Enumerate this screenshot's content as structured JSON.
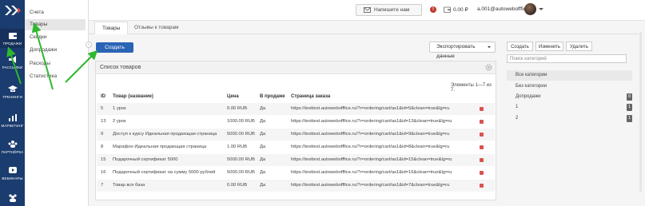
{
  "rail": {
    "items": [
      {
        "label": "ПРОДАЖИ",
        "icon": "wallet-icon"
      },
      {
        "label": "РАССЫЛКИ",
        "icon": "megaphone-icon"
      },
      {
        "label": "ТРЕНИНГИ",
        "icon": "graduation-cap-icon"
      },
      {
        "label": "МАРКЕТИНГ",
        "icon": "chart-icon"
      },
      {
        "label": "ПАРТНЁРКА",
        "icon": "people-icon"
      },
      {
        "label": "ВЕБИНАРЫ",
        "icon": "video-play-icon"
      },
      {
        "label": "",
        "icon": "group-icon"
      }
    ]
  },
  "submenu": {
    "items": [
      "Счета",
      "Товары",
      "Скидки",
      "Допродажи",
      "Расходы",
      "Статистика"
    ]
  },
  "header": {
    "message_button": "Напишите нам",
    "balance": "0.00 ₽",
    "user_email": "a.001@autowebofffice.ru"
  },
  "tabs": [
    "Товары",
    "Отзывы к товарам"
  ],
  "toolbar": {
    "create_label": "Создать",
    "export_label": "Экспортировать данные"
  },
  "products": {
    "title": "Список товаров",
    "counter": "Элементы 1—7 из 7.",
    "columns": [
      "ID",
      "Товар (название)",
      "Цена",
      "В продаже",
      "Страница заказа"
    ],
    "rows": [
      {
        "id": "5",
        "name": "1 урок",
        "price": "0.00 RUB",
        "on_sale": "Да",
        "url": "https://testtest.autowebofffice.ru/?r=ordering/cart/as1&id=5&clean=true&lg=ru"
      },
      {
        "id": "13",
        "name": "2 урок",
        "price": "1000.00 RUB",
        "on_sale": "Да",
        "url": "https://testtest.autowebofffice.ru/?r=ordering/cart/as1&id=13&clean=true&lg=ru"
      },
      {
        "id": "9",
        "name": "Доступ к курсу Идеальная продающая страница",
        "price": "5000.00 RUB",
        "on_sale": "Да",
        "url": "https://testtest.autowebofffice.ru/?r=ordering/cart/as1&id=9&clean=true&lg=ru"
      },
      {
        "id": "8",
        "name": "Марафон Идеальная продающая страница",
        "price": "1.00 RUB",
        "on_sale": "Да",
        "url": "https://testtest.autowebofffice.ru/?r=ordering/cart/as1&id=8&clean=true&lg=ru"
      },
      {
        "id": "15",
        "name": "Подарочный сертификат 5000",
        "price": "5000.00 RUB",
        "on_sale": "Да",
        "url": "https://testtest.autowebofffice.ru/?r=ordering/cart/as1&id=15&clean=true&lg=ru"
      },
      {
        "id": "16",
        "name": "Подарочный сертификат на сумму 5000 рублей",
        "price": "5000.00 RUB",
        "on_sale": "Да",
        "url": "https://testtest.autowebofffice.ru/?r=ordering/cart/as1&id=16&clean=true&lg=ru"
      },
      {
        "id": "7",
        "name": "Товар вся база",
        "price": "0.00 RUB",
        "on_sale": "Да",
        "url": "https://testtest.autowebofffice.ru/?r=ordering/cart/as1&id=7&clean=true&lg=ru"
      }
    ]
  },
  "categories": {
    "create": "Создать",
    "edit": "Изменить",
    "delete": "Удалить",
    "search_placeholder": "Поиск категорий",
    "items": [
      {
        "label": "Все категории",
        "badge": ""
      },
      {
        "label": "Без категории",
        "badge": ""
      },
      {
        "label": "Допродажи",
        "badge": "0"
      },
      {
        "label": "1",
        "badge": "1"
      },
      {
        "label": "2",
        "badge": "1"
      }
    ]
  },
  "colors": {
    "rail_bg": "#1a3c6e",
    "primary": "#2b64b5",
    "arrow": "#2eb82e",
    "danger": "#d9534f"
  }
}
